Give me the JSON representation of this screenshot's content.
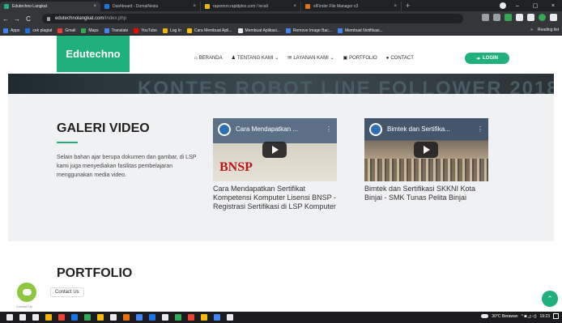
{
  "browser": {
    "tabs": [
      {
        "label": "Edutechno Langkat",
        "active": true,
        "color": "#1fb07b"
      },
      {
        "label": "Dashboard - DomaiNesia",
        "active": false,
        "color": "#1a73e8"
      },
      {
        "label": "rapemon.rapidplex.com / locall",
        "active": false,
        "color": "#f4b400"
      },
      {
        "label": "elFinder File Manager v3",
        "active": false,
        "color": "#e8710a"
      }
    ],
    "tab_close": "×",
    "new_tab": "+",
    "window_controls": [
      "–",
      "▢",
      "×"
    ],
    "nav": {
      "back": "←",
      "forward": "→",
      "reload": "C"
    },
    "url_host": "edutechnolangkat.com",
    "url_path": "/index.php",
    "bookmarks": [
      {
        "label": "Apps",
        "color": "#4285f4"
      },
      {
        "label": "cek plagiat",
        "color": "#1a73e8"
      },
      {
        "label": "Gmail",
        "color": "#ea4335"
      },
      {
        "label": "Maps",
        "color": "#34a853"
      },
      {
        "label": "Translate",
        "color": "#4285f4"
      },
      {
        "label": "YouTube",
        "color": "#ff0000"
      },
      {
        "label": "Log In",
        "color": "#f4b400"
      },
      {
        "label": "Cara Membuat Apli...",
        "color": "#fbbc04"
      },
      {
        "label": "Membuat Aplikasi...",
        "color": "#e8eaed"
      },
      {
        "label": "Remove Image Bac...",
        "color": "#4285f4"
      },
      {
        "label": "Membuat Notifikasi...",
        "color": "#4285f4"
      }
    ],
    "bookmarks_more": "»",
    "reading_list": "Reading list"
  },
  "site": {
    "brand": "Edutechno",
    "nav": [
      {
        "icon": "⌂",
        "label": "BERANDA"
      },
      {
        "icon": "♟",
        "label": "TENTANG KAMI ⌄"
      },
      {
        "icon": "✉",
        "label": "LAYANAN KAMI ⌄"
      },
      {
        "icon": "▣",
        "label": "PORTFOLIO"
      },
      {
        "icon": "●",
        "label": "CONTACT"
      }
    ],
    "login": "LOGIN",
    "login_icon": "➜",
    "banner_text": "KONTES ROBOT LINE FOLLOWER 2018",
    "gallery": {
      "title": "GALERI VIDEO",
      "description": "Selain bahan ajar berupa dokumen dan gambar, di LSP kami juga menyediakan fasilitas pembelajaran menggunakan media video.",
      "videos": [
        {
          "overlay_title": "Cara Mendapatkan ...",
          "badge": "BNSP",
          "caption": "Cara Mendapatkan Sertifikat Kompetensi Komputer Lisensi BNSP - Registrasi Sertifikasi di LSP Komputer"
        },
        {
          "overlay_title": "Bimtek dan Sertifika...",
          "caption": "Bimtek dan Sertifikasi SKKNI Kota Binjai - SMK Tunas Pelita Binjai"
        }
      ],
      "menu_icon": "⋮"
    },
    "portfolio_title": "PORTFOLIO",
    "chat_label": "Contact Us",
    "chat_caption": "Contact Us",
    "to_top": "⌃"
  },
  "taskbar": {
    "icons": [
      "#e8eaed",
      "#e8eaed",
      "#e8eaed",
      "#f4b400",
      "#ea4335",
      "#1a73e8",
      "#34a853",
      "#fbbc04",
      "#e8eaed",
      "#e8710a",
      "#4285f4",
      "#1a73e8",
      "#e8eaed",
      "#34a853",
      "#ea4335",
      "#fbbc04",
      "#4285f4",
      "#e8eaed"
    ],
    "weather": "30°C Berawan",
    "tray_icons": "^ ◙ ◿ ◁)",
    "time": "19:23"
  }
}
